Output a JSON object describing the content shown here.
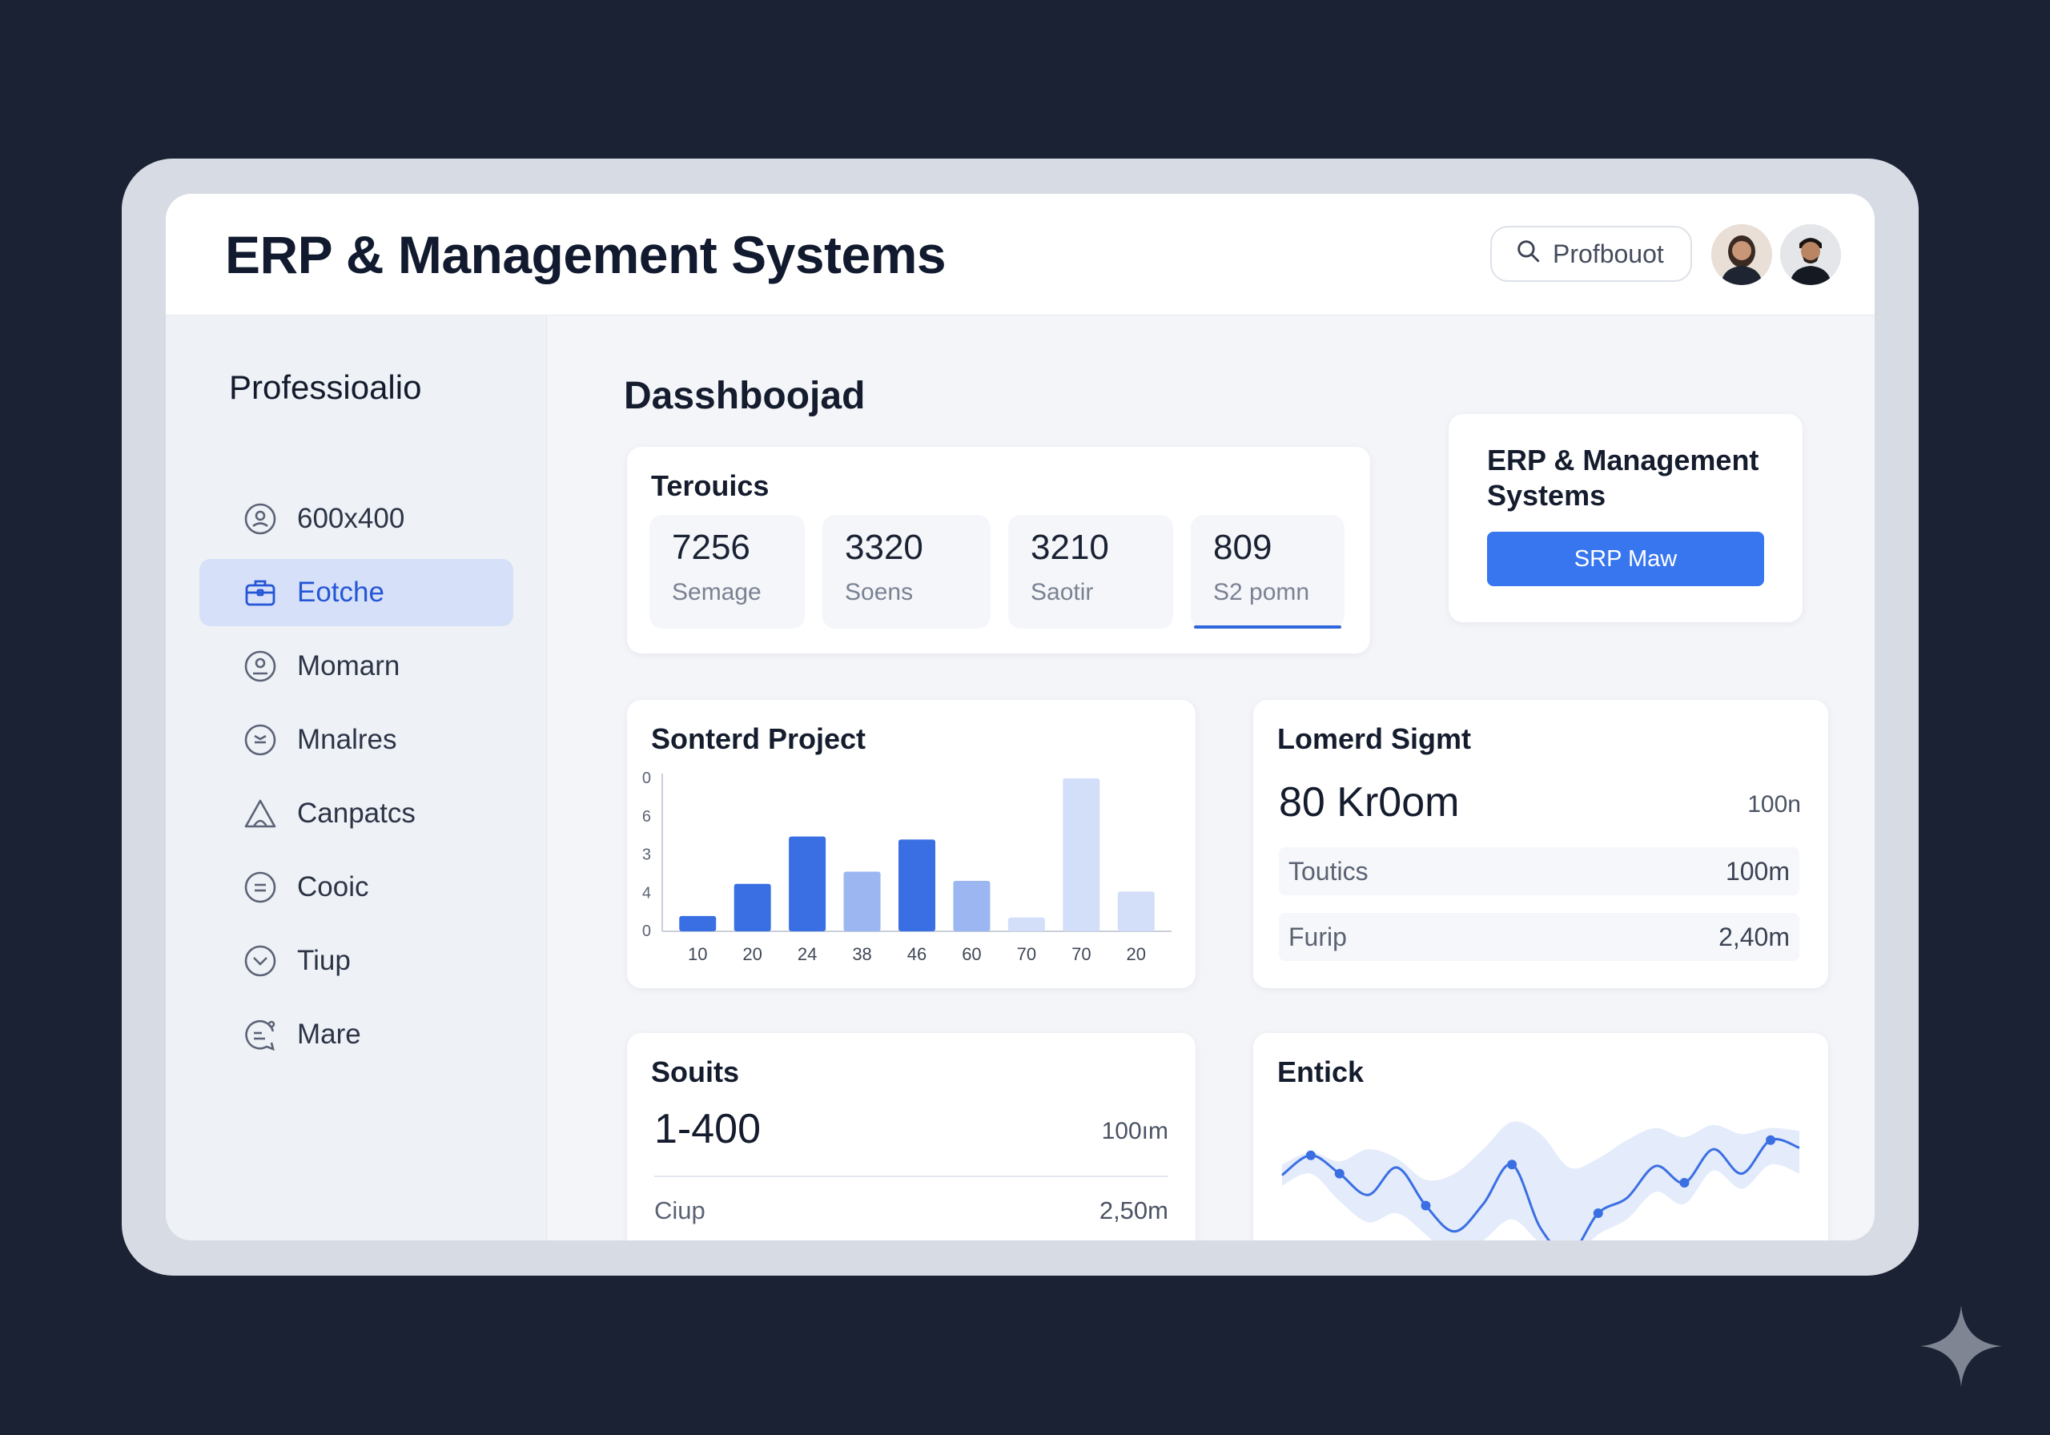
{
  "header": {
    "title": "ERP & Management Systems",
    "search_value": "Profbouot"
  },
  "sidebar": {
    "brand": "Professioalio",
    "items": [
      {
        "label": "600x400",
        "icon": "user-circle-icon",
        "active": false
      },
      {
        "label": "Eotche",
        "icon": "briefcase-icon",
        "active": true
      },
      {
        "label": "Momarn",
        "icon": "user-circle-icon",
        "active": false
      },
      {
        "label": "Mnalres",
        "icon": "list-circle-icon",
        "active": false
      },
      {
        "label": "Canpatcs",
        "icon": "tent-icon",
        "active": false
      },
      {
        "label": "Cooic",
        "icon": "minus-circle-icon",
        "active": false
      },
      {
        "label": "Tiup",
        "icon": "chevron-circle-icon",
        "active": false
      },
      {
        "label": "Mare",
        "icon": "chat-user-icon",
        "active": false
      }
    ]
  },
  "main": {
    "title": "Dasshboojad",
    "metrics_card": {
      "title": "Terouics",
      "metrics": [
        {
          "value": "7256",
          "label": "Semage"
        },
        {
          "value": "3320",
          "label": "Soens"
        },
        {
          "value": "3210",
          "label": "Saotir"
        },
        {
          "value": "809",
          "label": "S2 pomn"
        }
      ]
    },
    "erp_card": {
      "title": "ERP & Management Systems",
      "button_label": "SRP Maw"
    },
    "bar_card": {
      "title": "Sonterd Project"
    },
    "lomerd_card": {
      "title": "Lomerd Sigmt",
      "big_value": "80 Kr0om",
      "big_side": "100n",
      "rows": [
        {
          "label": "Toutics",
          "value": "100m"
        },
        {
          "label": "Furip",
          "value": "2,40m"
        }
      ]
    },
    "souits_card": {
      "title": "Souits",
      "big_value": "1-400",
      "big_side": "100ım",
      "row": {
        "label": "Ciup",
        "value": "2,50m"
      }
    },
    "entick_card": {
      "title": "Entick"
    }
  },
  "colors": {
    "background": "#1b2233",
    "accent": "#3876ef",
    "bar_dark": "#3a6fe3",
    "bar_mid": "#9bb6f1",
    "bar_light": "#d3def8"
  },
  "chart_data": [
    {
      "type": "bar",
      "title": "Sonterd Project",
      "categories": [
        "10",
        "20",
        "24",
        "38",
        "46",
        "60",
        "70",
        "70",
        "20"
      ],
      "y_tick_labels": [
        "0",
        "4",
        "3",
        "6",
        "0"
      ],
      "values": [
        1,
        3.1,
        6.2,
        3.9,
        6,
        3.3,
        0.9,
        10,
        2.6
      ],
      "shade": [
        "dark",
        "dark",
        "dark",
        "mid",
        "dark",
        "mid",
        "light",
        "light",
        "light"
      ],
      "ylim": [
        0,
        10
      ]
    },
    {
      "type": "line",
      "title": "Entick",
      "x": [
        0,
        1,
        2,
        3,
        4,
        5,
        6,
        7,
        8,
        9,
        10,
        11,
        12,
        13,
        14,
        15,
        16,
        17,
        18
      ],
      "values": [
        5.5,
        6.8,
        5.6,
        4.2,
        6.0,
        3.5,
        1.8,
        3.6,
        6.2,
        2.0,
        0.3,
        3.0,
        4.0,
        6.1,
        5.0,
        7.2,
        5.6,
        7.8,
        7.3
      ],
      "band_upper": [
        6.2,
        7.0,
        6.4,
        7.2,
        6.6,
        5.2,
        5.6,
        7.2,
        9.0,
        8.2,
        6.0,
        6.6,
        7.8,
        8.6,
        8.0,
        8.8,
        8.2,
        8.6,
        8.4
      ],
      "band_lower": [
        4.8,
        5.6,
        3.8,
        2.4,
        3.0,
        1.6,
        0.0,
        1.2,
        2.6,
        1.0,
        0.0,
        1.6,
        2.6,
        4.4,
        3.6,
        5.8,
        4.6,
        6.2,
        5.6
      ],
      "ylim": [
        0,
        10
      ]
    }
  ]
}
